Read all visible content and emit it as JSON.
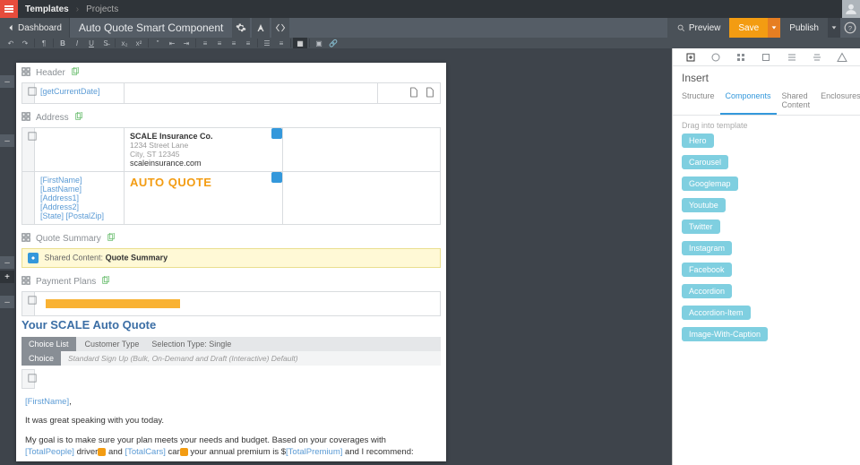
{
  "top": {
    "crumb1": "Templates",
    "crumb2": "Projects"
  },
  "titlebar": {
    "back": "Dashboard",
    "title": "Auto Quote Smart Component",
    "preview": "Preview",
    "save": "Save",
    "publish": "Publish"
  },
  "sections": {
    "header": "Header",
    "address": "Address",
    "quote_summary": "Quote Summary",
    "payment_plans": "Payment Plans"
  },
  "header_block": {
    "date_ph": "[getCurrentDate]"
  },
  "address_block": {
    "company": "SCALE Insurance Co.",
    "line1": "1234 Street Lane",
    "line2": "City, ST 12345",
    "site": "scaleinsurance.com",
    "name_ph": "[FirstName] [LastName]",
    "addr1_ph": "[Address1]",
    "addr2_ph": "[Address2]",
    "state_ph": "[State] [PostalZip]",
    "auto_quote": "AUTO QUOTE"
  },
  "shared": {
    "prefix": "Shared Content: ",
    "name": "Quote Summary"
  },
  "quote": {
    "heading": "Your SCALE Auto Quote",
    "choice_list": "Choice List",
    "customer_type": "Customer Type",
    "sel_label": "Selection Type:",
    "sel_val": "Single",
    "choice": "Choice",
    "choice_desc": "Standard Sign Up (Bulk, On-Demand and Draft (Interactive) Default)"
  },
  "letter": {
    "greet_name": "[FirstName]",
    "greet_comma": ",",
    "l1": "It was great speaking with you today.",
    "l2a": "My goal is to make sure your plan meets your needs and budget. Based on your coverages with ",
    "total_people": "[TotalPeople]",
    "l2b": " driver",
    "l2c": " and ",
    "total_cars": "[TotalCars]",
    "l2d": " car",
    "l2e": " your annual premium is $",
    "total_premium": "[TotalPremium]",
    "l2f": " and I recommend:"
  },
  "panel": {
    "title": "Insert",
    "tabs": {
      "structure": "Structure",
      "components": "Components",
      "shared": "Shared Content",
      "enclosures": "Enclosures"
    },
    "hint": "Drag into template",
    "chips": [
      "Hero",
      "Carousel",
      "Googlemap",
      "Youtube",
      "Twitter",
      "Instagram",
      "Facebook",
      "Accordion",
      "Accordion-Item",
      "Image-With-Caption"
    ]
  }
}
